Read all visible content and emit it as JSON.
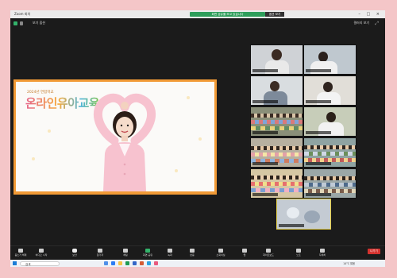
{
  "window": {
    "title": "Zoom 회의",
    "share_banner": "화면 공유를 보고 있습니다",
    "share_stop": "옵션 보기",
    "window_controls": "–  □  ×"
  },
  "header": {
    "view_label": "보기 옵션",
    "speaker_view_label": "갤러리 보기"
  },
  "featured": {
    "year_text": "2024년 연합학교",
    "program_title": "온라인유아교육"
  },
  "gallery": {
    "tiles": [
      {
        "name": ""
      },
      {
        "name": ""
      },
      {
        "name": ""
      },
      {
        "name": ""
      },
      {
        "name": ""
      },
      {
        "name": ""
      },
      {
        "name": ""
      },
      {
        "name": ""
      },
      {
        "name": ""
      },
      {
        "name": ""
      },
      {
        "name": ""
      }
    ]
  },
  "toolbar": {
    "items": [
      {
        "label": "음소거 해제",
        "icon": "mic-icon"
      },
      {
        "label": "비디오 시작",
        "icon": "video-icon"
      },
      {
        "label": "보안",
        "icon": "shield-icon"
      },
      {
        "label": "참가자",
        "icon": "participants-icon"
      },
      {
        "label": "채팅",
        "icon": "chat-icon"
      },
      {
        "label": "화면 공유",
        "icon": "share-screen-icon"
      },
      {
        "label": "녹화",
        "icon": "record-icon"
      },
      {
        "label": "반응",
        "icon": "reactions-icon"
      },
      {
        "label": "소회의실",
        "icon": "breakout-icon"
      },
      {
        "label": "앱",
        "icon": "apps-icon"
      },
      {
        "label": "화이트보드",
        "icon": "whiteboard-icon"
      },
      {
        "label": "노트",
        "icon": "notes-icon"
      },
      {
        "label": "자세히",
        "icon": "more-icon"
      }
    ],
    "end_label": "나가기"
  },
  "taskbar": {
    "search_placeholder": "검색",
    "weather": "14°C 맑음",
    "clock": ""
  },
  "colors": {
    "page_background": "#f4c6c8",
    "speaker_frame": "#f19a36",
    "share_banner": "#2e9e5b",
    "end_button": "#d5332f"
  }
}
